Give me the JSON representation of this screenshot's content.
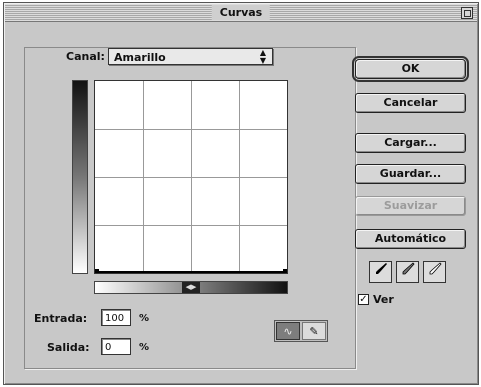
{
  "window": {
    "title": "Curvas"
  },
  "channel": {
    "label": "Canal:",
    "value": "Amarillo"
  },
  "input": {
    "label": "Entrada:",
    "value": "100",
    "unit": "%"
  },
  "output": {
    "label": "Salida:",
    "value": "0",
    "unit": "%"
  },
  "buttons": {
    "ok": "OK",
    "cancel": "Cancelar",
    "load": "Cargar...",
    "save": "Guardar...",
    "smooth": "Suavizar",
    "auto": "Automático"
  },
  "preview": {
    "label": "Ver",
    "checked": true
  },
  "icons": {
    "zoom": "zoom-box-icon",
    "eyedroppers": [
      "black-eyedropper-icon",
      "gray-eyedropper-icon",
      "white-eyedropper-icon"
    ],
    "curve_mode": "curve-point-icon",
    "pencil_mode": "pencil-icon",
    "gradient_toggle": "gradient-toggle-icon"
  },
  "colors": {
    "dialog_bg": "#c8c8c8",
    "border": "#333333"
  }
}
